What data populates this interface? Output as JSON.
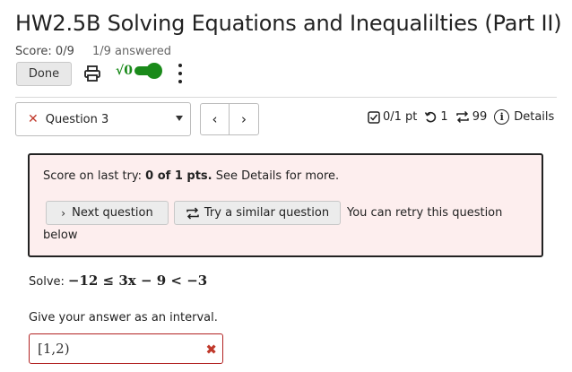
{
  "assignment": {
    "title": "HW2.5B Solving Equations and Inequalilties (Part II)",
    "score_label": "Score: 0/9",
    "answered_label": "1/9 answered",
    "done_label": "Done",
    "math_toggle_label": "√0"
  },
  "question_nav": {
    "selected_question": "Question 3",
    "prev_symbol": "‹",
    "next_symbol": "›"
  },
  "stats": {
    "points": "0/1 pt",
    "retries_used": "1",
    "attempts_left": "99",
    "details_label": "Details"
  },
  "alert": {
    "score_prefix": "Score on last try: ",
    "score_value": "0 of 1 pts.",
    "score_suffix": " See Details for more.",
    "next_question_label": "Next question",
    "similar_question_label": "Try a similar question",
    "retry_line_1": "You can retry this question",
    "retry_line_2": "below"
  },
  "question": {
    "solve_label": "Solve:",
    "inequality": "−12 ≤ 3x − 9 < −3",
    "instruction": "Give your answer as an interval.",
    "answer_value": "[1,2)"
  },
  "colors": {
    "accent_green": "#1a8a1a",
    "error_red": "#b22222",
    "alert_bg": "#fdeeee"
  },
  "icons": {
    "print": "print-icon",
    "kebab": "kebab-menu-icon",
    "points": "checkbox-icon",
    "retry": "retry-icon",
    "attempts": "attempts-icon",
    "details": "info-icon",
    "wrong": "x-icon"
  }
}
